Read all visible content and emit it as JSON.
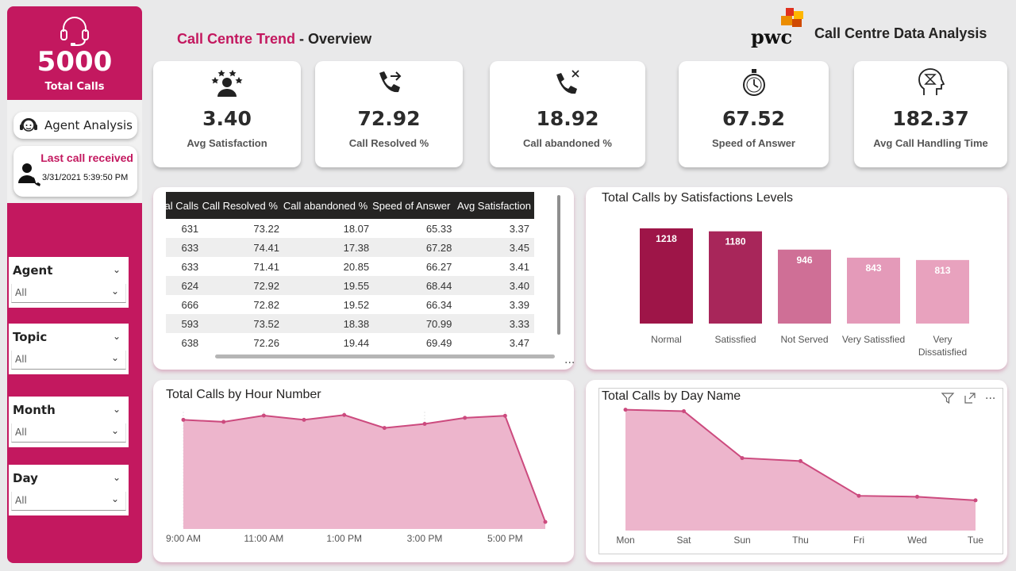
{
  "header": {
    "title_part1": "Call Centre Trend",
    "title_sep": " - ",
    "title_part2": "Overview",
    "brand_logo_text": "pwc",
    "brand_title": "Call Centre Data Analysis"
  },
  "sidebar": {
    "total_calls_value": "5000",
    "total_calls_label": "Total Calls",
    "agent_analysis_label": "Agent Analysis",
    "last_call_label": "Last call received",
    "last_call_value": "3/31/2021 5:39:50 PM",
    "slicers": [
      {
        "title": "Agent",
        "value": "All"
      },
      {
        "title": "Topic",
        "value": "All"
      },
      {
        "title": "Month",
        "value": "All"
      },
      {
        "title": "Day",
        "value": "All"
      }
    ]
  },
  "kpis": [
    {
      "value": "3.40",
      "label": "Avg Satisfaction",
      "icon": "rating-stars-icon"
    },
    {
      "value": "72.92",
      "label": "Call Resolved %",
      "icon": "phone-forward-icon"
    },
    {
      "value": "18.92",
      "label": "Call abandoned %",
      "icon": "phone-missed-icon"
    },
    {
      "value": "67.52",
      "label": "Speed of Answer",
      "icon": "stopwatch-icon"
    },
    {
      "value": "182.37",
      "label": "Avg Call Handling Time",
      "icon": "head-hourglass-icon"
    }
  ],
  "table": {
    "headers": [
      "Total Calls",
      "Call Resolved %",
      "Call abandoned %",
      "Speed of Answer",
      "Avg Satisfaction"
    ],
    "rows": [
      [
        "631",
        "73.22",
        "18.07",
        "65.33",
        "3.37"
      ],
      [
        "633",
        "74.41",
        "17.38",
        "67.28",
        "3.45"
      ],
      [
        "633",
        "71.41",
        "20.85",
        "66.27",
        "3.41"
      ],
      [
        "624",
        "72.92",
        "19.55",
        "68.44",
        "3.40"
      ],
      [
        "666",
        "72.82",
        "19.52",
        "66.34",
        "3.39"
      ],
      [
        "593",
        "73.52",
        "18.38",
        "70.99",
        "3.33"
      ],
      [
        "638",
        "72.26",
        "19.44",
        "69.49",
        "3.47"
      ]
    ],
    "more_options": "..."
  },
  "colors": {
    "brand": "#c3185f",
    "bar_dark": "#9e1548",
    "bar_mid": "#a8265a",
    "bar_light1": "#cf6f96",
    "bar_light2": "#e49ab9",
    "bar_light3": "#e8a2be",
    "area_fill": "#edb5cc",
    "area_line": "#cc4a7e"
  },
  "chart_data": [
    {
      "type": "bar",
      "title": "Total Calls by Satisfactions Levels",
      "categories": [
        "Normal",
        "Satissfied",
        "Not Served",
        "Very Satissfied",
        "Very Dissatisfied"
      ],
      "category_labels": [
        [
          "Normal"
        ],
        [
          "Satissfied"
        ],
        [
          "Not Served"
        ],
        [
          "Very Satissfied"
        ],
        [
          "Very",
          "Dissatisfied"
        ]
      ],
      "values": [
        1218,
        1180,
        946,
        843,
        813
      ],
      "data_labels": [
        "1218",
        "1180",
        "946",
        "843",
        "813"
      ],
      "ylim": [
        0,
        1400
      ]
    },
    {
      "type": "area",
      "title": "Total Calls by Hour Number",
      "x": [
        9,
        10,
        11,
        12,
        13,
        14,
        15,
        16,
        17,
        18
      ],
      "values": [
        540,
        530,
        561,
        540,
        564,
        500,
        520,
        550,
        560,
        35
      ],
      "tick_labels": [
        {
          "x": 9,
          "label": "9:00 AM"
        },
        {
          "x": 11,
          "label": "11:00 AM"
        },
        {
          "x": 13,
          "label": "1:00 PM"
        },
        {
          "x": 15,
          "label": "3:00 PM"
        },
        {
          "x": 17,
          "label": "5:00 PM"
        }
      ],
      "ylim": [
        0,
        620
      ]
    },
    {
      "type": "area",
      "title": "Total Calls by Day Name",
      "categories": [
        "Mon",
        "Sat",
        "Sun",
        "Thu",
        "Fri",
        "Wed",
        "Tue"
      ],
      "values": [
        800,
        795,
        640,
        630,
        515,
        512,
        500
      ],
      "ylim": [
        400,
        820
      ]
    }
  ]
}
